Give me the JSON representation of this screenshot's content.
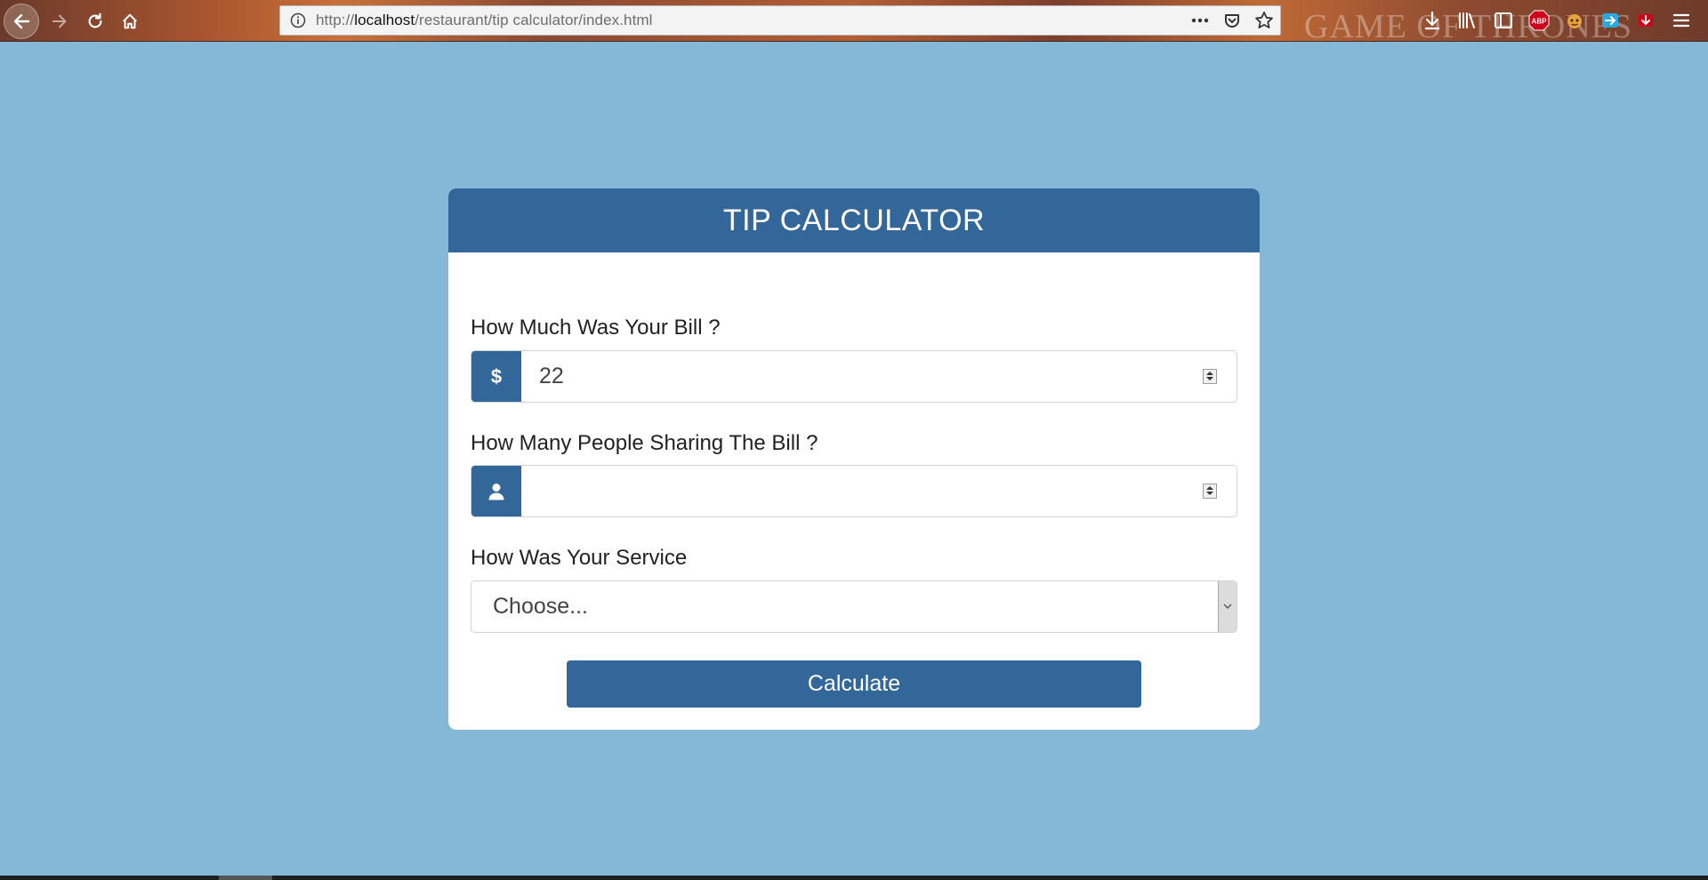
{
  "browser": {
    "url_prefix": "http://",
    "url_host": "localhost",
    "url_path": "/restaurant/tip calculator/index.html",
    "brand_text": "GAME OF THRONES",
    "icons": [
      "back-icon",
      "forward-icon",
      "reload-icon",
      "home-icon",
      "info-icon",
      "more-icon",
      "pocket-icon",
      "bookmark-star-icon",
      "download-icon",
      "library-icon",
      "sidebar-icon",
      "adblock-icon",
      "extension-icon",
      "extension-icon",
      "extension-icon",
      "menu-icon"
    ],
    "adblock_label": "ABP"
  },
  "card": {
    "title": "TIP CALCULATOR",
    "accent_color": "#336699",
    "background_color": "#84b8d6"
  },
  "bill": {
    "label": "How Much Was Your Bill ?",
    "addon_symbol": "$",
    "value": "22"
  },
  "people": {
    "label": "How Many People Sharing The Bill ?",
    "addon_icon": "user-icon",
    "value": ""
  },
  "service": {
    "label": "How Was Your Service",
    "selected": "Choose..."
  },
  "calculate": {
    "label": "Calculate"
  }
}
